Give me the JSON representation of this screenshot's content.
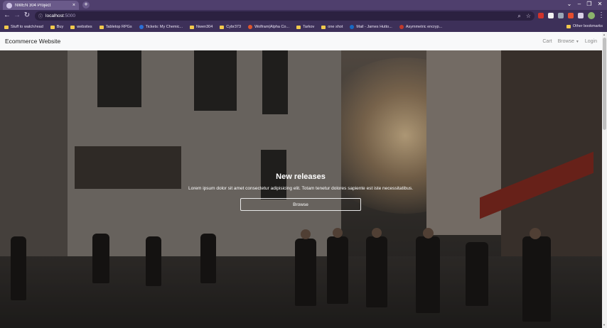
{
  "browser": {
    "tab_title": "NWEN 304 Project",
    "url_host": "localhost",
    "url_port": ":5000",
    "bookmarks": [
      "Stuff to watch/read",
      "Buy",
      "websites",
      "Tabletop RPGs",
      "Tickets: My Chemic...",
      "Nwen304",
      "Cybr373",
      "Wolfram|Alpha Co...",
      "Tarkov",
      "one shot",
      "Mail - James Hutto...",
      "Asymmetric encryp..."
    ],
    "other_bookmarks": "Other bookmarks"
  },
  "navbar": {
    "brand": "Ecommerce Website",
    "cart": "Cart",
    "browse": "Browse",
    "login": "Login"
  },
  "hero": {
    "title": "New releases",
    "text": "Lorem ipsum dolor sit amet consectetur adipisicing elit. Totam tenetur dolores sapiente est iste necessitatibus.",
    "button": "Browse"
  },
  "colors": {
    "tab_strip": "#4f3f6d",
    "toolbar": "#3d3059",
    "navbar_bg": "#f8f9fa"
  }
}
